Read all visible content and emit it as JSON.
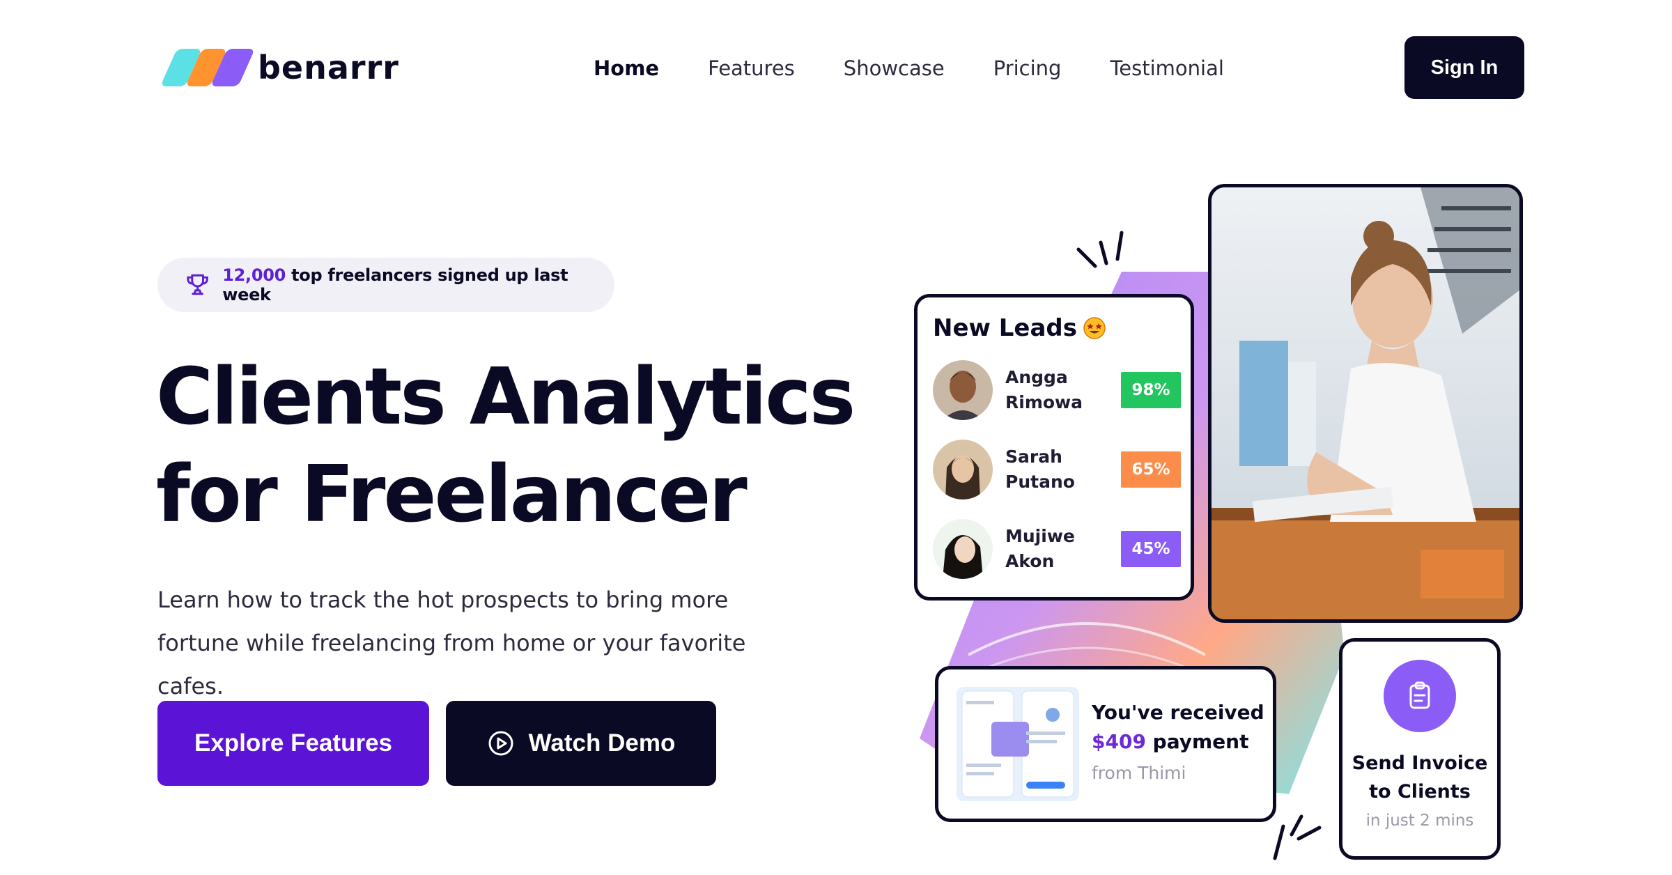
{
  "brand": {
    "name": "benarrr"
  },
  "nav": {
    "items": [
      "Home",
      "Features",
      "Showcase",
      "Pricing",
      "Testimonial"
    ],
    "active": "Home",
    "sign_in": "Sign In"
  },
  "hero": {
    "badge": {
      "count": "12,000",
      "text": " top freelancers signed up last week"
    },
    "headline_line1": "Clients Analytics",
    "headline_line2": "for Freelancer",
    "subtitle": "Learn how to track the hot prospects to bring more fortune while freelancing from home or your favorite cafes.",
    "primary_cta": "Explore Features",
    "secondary_cta": "Watch Demo"
  },
  "leads_card": {
    "title": "New Leads",
    "leads": [
      {
        "name": "Angga Rimowa",
        "percent": "98%",
        "color": "#22c55e"
      },
      {
        "name": "Sarah Putano",
        "percent": "65%",
        "color": "#fb8c4a"
      },
      {
        "name": "Mujiwe Akon",
        "percent": "45%",
        "color": "#8b5cf6"
      }
    ]
  },
  "payment_card": {
    "line1": "You've received",
    "amount": "$409",
    "line2_suffix": " payment",
    "from": "from Thimi"
  },
  "invoice_card": {
    "title": "Send Invoice\nto Clients",
    "subtitle": "in just 2 mins"
  },
  "colors": {
    "primary": "#5b13d6",
    "dark": "#0b0a24",
    "accent_purple": "#8b5cf6",
    "accent_orange": "#ff9330",
    "accent_cyan": "#5be0e6"
  }
}
